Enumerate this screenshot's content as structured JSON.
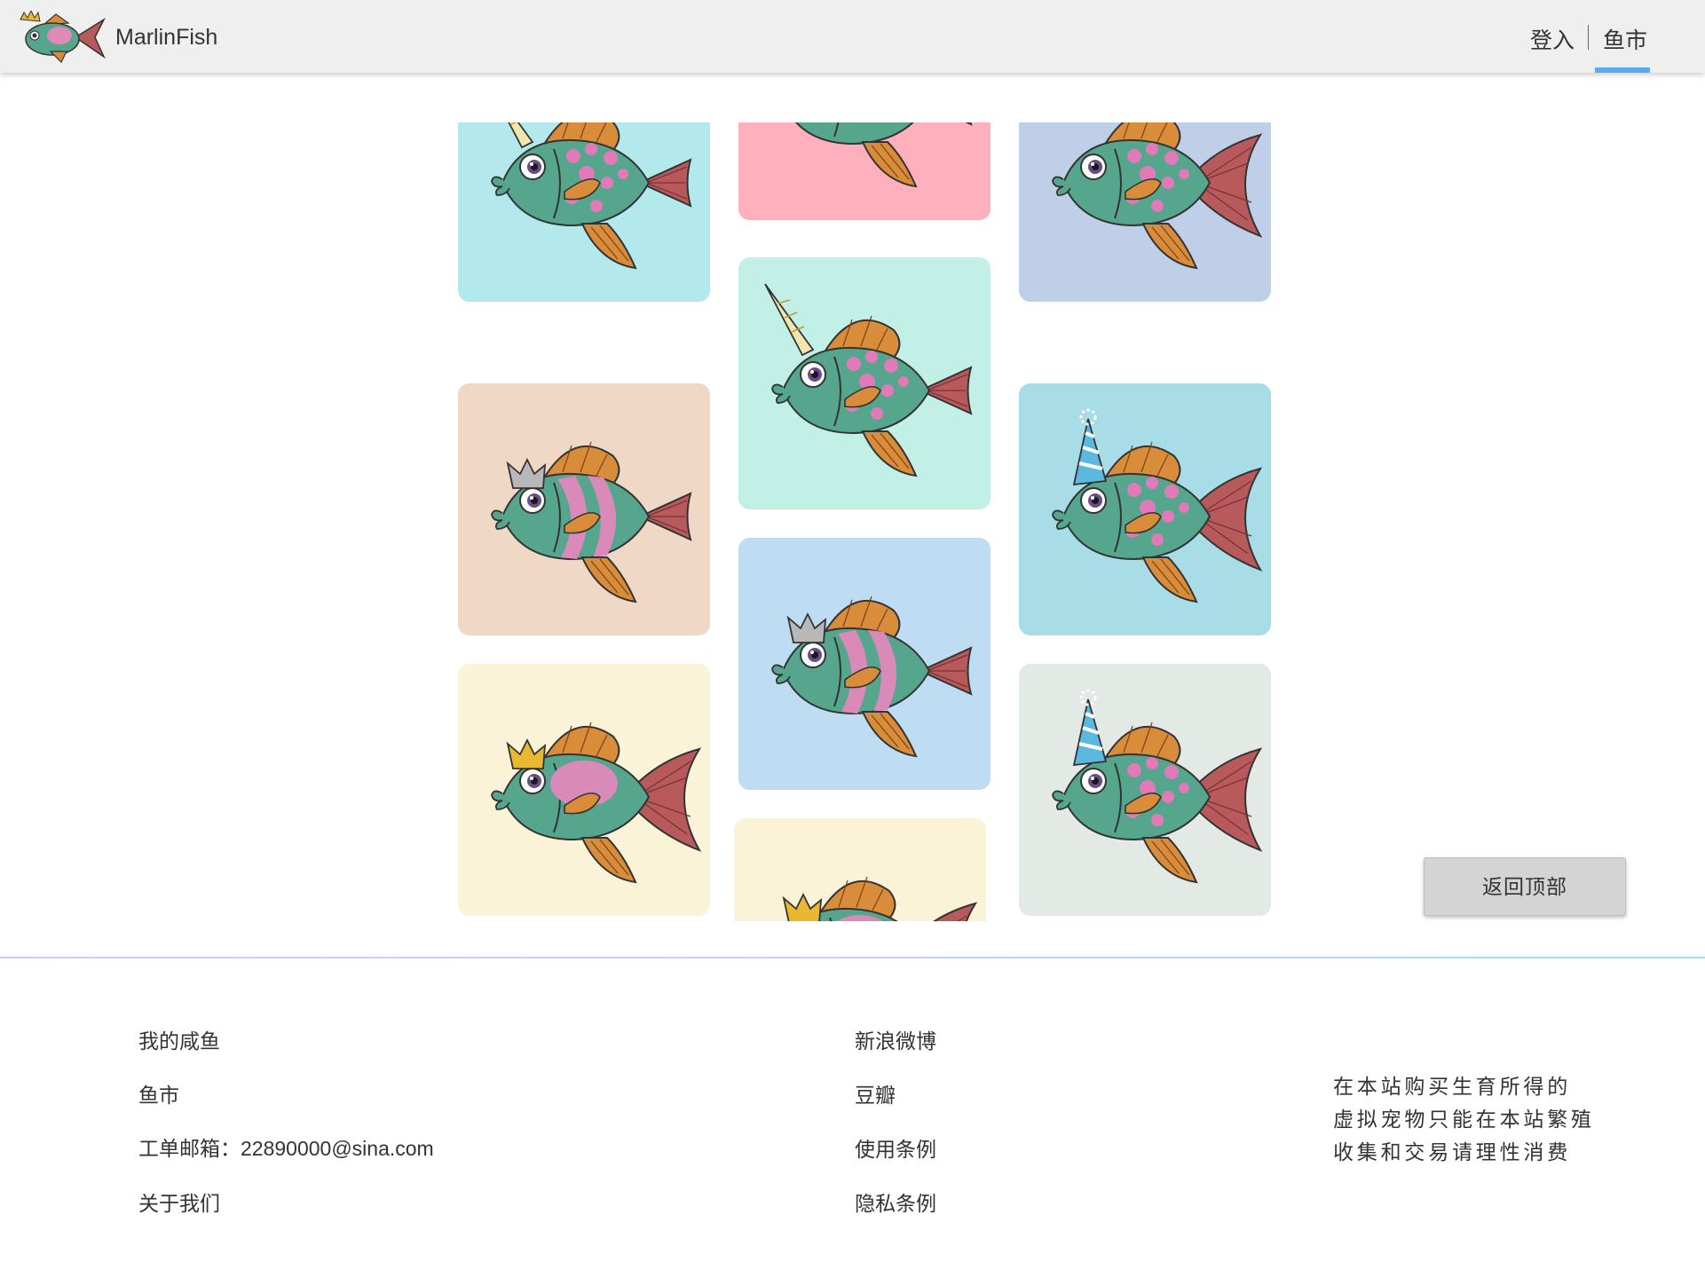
{
  "header": {
    "brand": "MarlinFish",
    "nav": {
      "login": "登入",
      "market": "鱼市",
      "active": "market"
    }
  },
  "colors": {
    "header_bg": "#efefef",
    "accent_underline": "#5aaaf2",
    "fish_body": "#55a68c",
    "fin": "#d98c3a",
    "tail_red": "#b85a5c",
    "spot": "#e07ab8"
  },
  "gallery": {
    "cards": [
      {
        "bg": "#b3e8ec",
        "horn": "unicorn",
        "pattern": "spots",
        "tail": "short-red"
      },
      {
        "bg": "#ffb0bc",
        "horn": "none",
        "pattern": "none",
        "tail": "red"
      },
      {
        "bg": "#bfcfe8",
        "horn": "none",
        "pattern": "spots",
        "tail": "long-red"
      },
      {
        "bg": "#c2f0e6",
        "horn": "unicorn",
        "pattern": "spots",
        "tail": "short-red"
      },
      {
        "bg": "#f0d8c6",
        "horn": "silver-crown",
        "pattern": "stripes",
        "tail": "short-red"
      },
      {
        "bg": "#a8dde8",
        "horn": "party-hat",
        "pattern": "spots",
        "tail": "long-red"
      },
      {
        "bg": "#bedcf2",
        "horn": "silver-crown",
        "pattern": "stripes",
        "tail": "short-red"
      },
      {
        "bg": "#faf3d8",
        "horn": "gold-crown",
        "pattern": "pink-blob",
        "tail": "long-red"
      },
      {
        "bg": "#e3e9e4",
        "horn": "party-hat",
        "pattern": "spots",
        "tail": "long-red"
      },
      {
        "bg": "#faf3d8",
        "horn": "gold-crown",
        "pattern": "pink-blob",
        "tail": "long-red"
      }
    ]
  },
  "back_to_top": "返回顶部",
  "footer": {
    "col1": [
      "我的咸鱼",
      "鱼市",
      "工单邮箱：22890000@sina.com",
      "关于我们"
    ],
    "col2": [
      "新浪微博",
      "豆瓣",
      "使用条例",
      "隐私条例"
    ],
    "slogan": [
      "在本站购买生育所得的",
      "虚拟宠物只能在本站繁殖",
      "收集和交易请理性消费"
    ]
  }
}
